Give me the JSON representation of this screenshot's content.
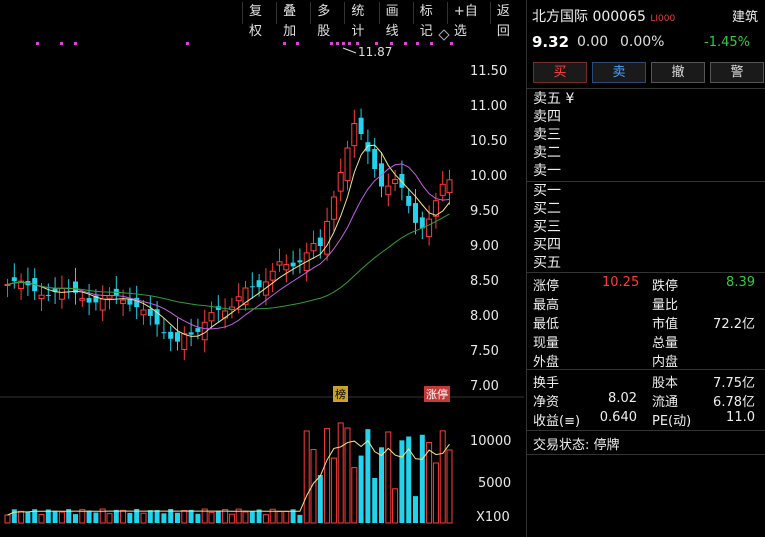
{
  "toolbar": [
    "复权",
    "叠加",
    "多股",
    "统计",
    "画线",
    "标记",
    "+自选",
    "返回"
  ],
  "price_axis": [
    "11.50",
    "11.00",
    "10.50",
    "10.00",
    "9.50",
    "9.00",
    "8.50",
    "8.00",
    "7.50",
    "7.00"
  ],
  "vol_axis": [
    "10000",
    "5000",
    "X100"
  ],
  "markers": {
    "high": "11.87",
    "bang": "榜",
    "zt": "涨停"
  },
  "stock": {
    "name": "北方国际 000065",
    "level": "LI000",
    "industry": "建筑",
    "price": "9.32",
    "change": "0.00",
    "pct": "0.00%",
    "industry_chg": "-1.45%"
  },
  "actions": [
    "买",
    "卖",
    "撤",
    "警"
  ],
  "orderbook": {
    "sell": [
      "卖五 ¥",
      "卖四",
      "卖三",
      "卖二",
      "卖一"
    ],
    "buy": [
      "买一",
      "买二",
      "买三",
      "买四",
      "买五"
    ]
  },
  "stats": {
    "zt_label": "涨停",
    "zt": "10.25",
    "dt_label": "跌停",
    "dt": "8.39",
    "high_label": "最高",
    "lb_label": "量比",
    "low_label": "最低",
    "mv_label": "市值",
    "mv": "72.2亿",
    "xl_label": "现量",
    "zl_label": "总量",
    "wp_label": "外盘",
    "np_label": "内盘",
    "hs_label": "换手",
    "gb_label": "股本",
    "gb": "7.75亿",
    "jz_label": "净资",
    "jz": "8.02",
    "lt_label": "流通",
    "lt": "6.78亿",
    "sy_label": "收益(≡)",
    "sy": "0.640",
    "pe_label": "PE(动)",
    "pe": "11.0"
  },
  "status": "交易状态: 停牌",
  "colors": {
    "up": "#ff3b3b",
    "down": "#22d3ee",
    "ma5": "#f0e68c",
    "ma10": "#c060e0",
    "ma20": "#2e9e3a"
  }
}
